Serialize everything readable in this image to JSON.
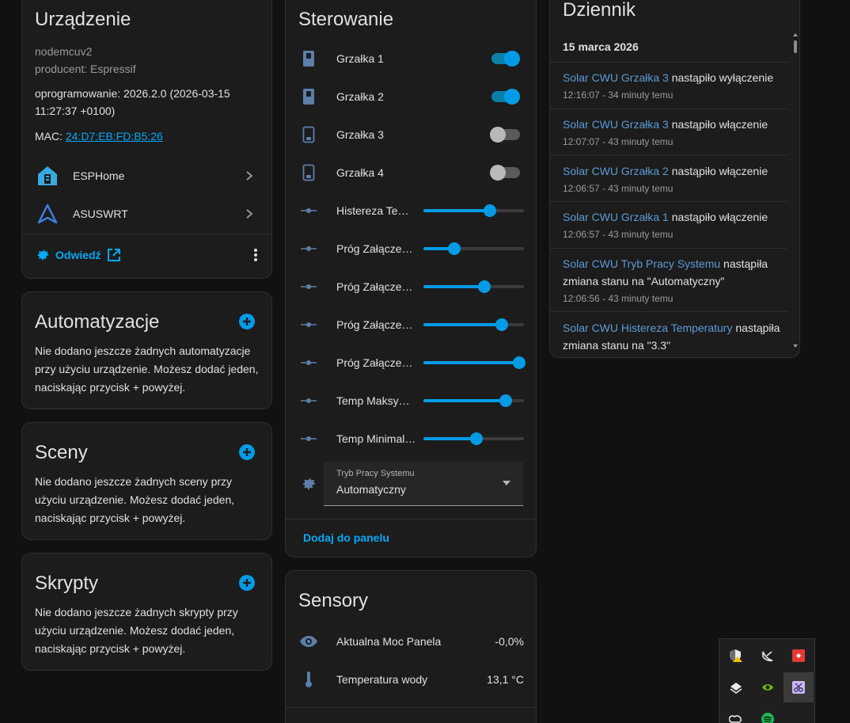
{
  "device": {
    "title": "Urządzenie",
    "model": "nodemcuv2",
    "manufacturer": "producent: Espressif",
    "firmware": "oprogramowanie: 2026.2.0 (2026-03-15 11:27:37 +0100)",
    "mac_label": "MAC: ",
    "mac_value": "24:D7:EB:FD:B5:26",
    "integrations": [
      {
        "label": "ESPHome",
        "icon": "esphome-icon"
      },
      {
        "label": "ASUSWRT",
        "icon": "asus-icon"
      }
    ],
    "visit_label": "Odwiedź"
  },
  "automations": {
    "title": "Automatyzacje",
    "description": "Nie dodano jeszcze żadnych automatyzacje przy użyciu urządzenie. Możesz dodać jeden, naciskając przycisk + powyżej."
  },
  "scenes": {
    "title": "Sceny",
    "description": "Nie dodano jeszcze żadnych sceny przy użyciu urządzenie. Możesz dodać jeden, naciskając przycisk + powyżej."
  },
  "scripts": {
    "title": "Skrypty",
    "description": "Nie dodano jeszcze żadnych skrypty przy użyciu urządzenie. Możesz dodać jeden, naciskając przycisk + powyżej."
  },
  "controls": {
    "title": "Sterowanie",
    "switches": [
      {
        "label": "Grzałka 1",
        "on": true
      },
      {
        "label": "Grzałka 2",
        "on": true
      },
      {
        "label": "Grzałka 3",
        "on": false
      },
      {
        "label": "Grzałka 4",
        "on": false
      }
    ],
    "sliders": [
      {
        "label": "Histereza Te…",
        "level": 0.66
      },
      {
        "label": "Próg Załączen…",
        "level": 0.31
      },
      {
        "label": "Próg Załączen…",
        "level": 0.61
      },
      {
        "label": "Próg Załączen…",
        "level": 0.78
      },
      {
        "label": "Próg Załączen…",
        "level": 0.95
      },
      {
        "label": "Temp Maksy…",
        "level": 0.82
      },
      {
        "label": "Temp Minimal…",
        "level": 0.53
      }
    ],
    "select": {
      "label": "Tryb Pracy Systemu",
      "value": "Automatyczny"
    },
    "add_to_panel": "Dodaj do panelu"
  },
  "sensors": {
    "title": "Sensory",
    "items": [
      {
        "label": "Aktualna Moc Panela",
        "value": "-0,0%",
        "icon": "eye-icon"
      },
      {
        "label": "Temperatura wody",
        "value": "13,1 °C",
        "icon": "thermometer-icon"
      }
    ]
  },
  "logbook": {
    "title": "Dziennik",
    "date": "15 marca 2026",
    "entries": [
      {
        "entity": "Solar CWU Grzałka 3",
        "text": " nastąpiło wyłączenie",
        "time": "12:16:07 - 34 minuty temu"
      },
      {
        "entity": "Solar CWU Grzałka 3",
        "text": " nastąpiło włączenie",
        "time": "12:07:07 - 43 minuty temu"
      },
      {
        "entity": "Solar CWU Grzałka 2",
        "text": " nastąpiło włączenie",
        "time": "12:06:57 - 43 minuty temu"
      },
      {
        "entity": "Solar CWU Grzałka 1",
        "text": " nastąpiło włączenie",
        "time": "12:06:57 - 43 minuty temu"
      },
      {
        "entity": "Solar CWU Tryb Pracy Systemu",
        "text": " nastąpiła zmiana stanu na \"Automatyczny\"",
        "time": "12:06:56 - 43 minuty temu"
      },
      {
        "entity": "Solar CWU Histereza Temperatury",
        "text": " nastąpiła zmiana stanu na \"3.3\"",
        "time": ""
      }
    ]
  },
  "colors": {
    "accent": "#03a9f4",
    "slider": "#039be5",
    "background": "#111111",
    "card": "#1c1c1c",
    "entity_link": "#5b9bd5"
  }
}
